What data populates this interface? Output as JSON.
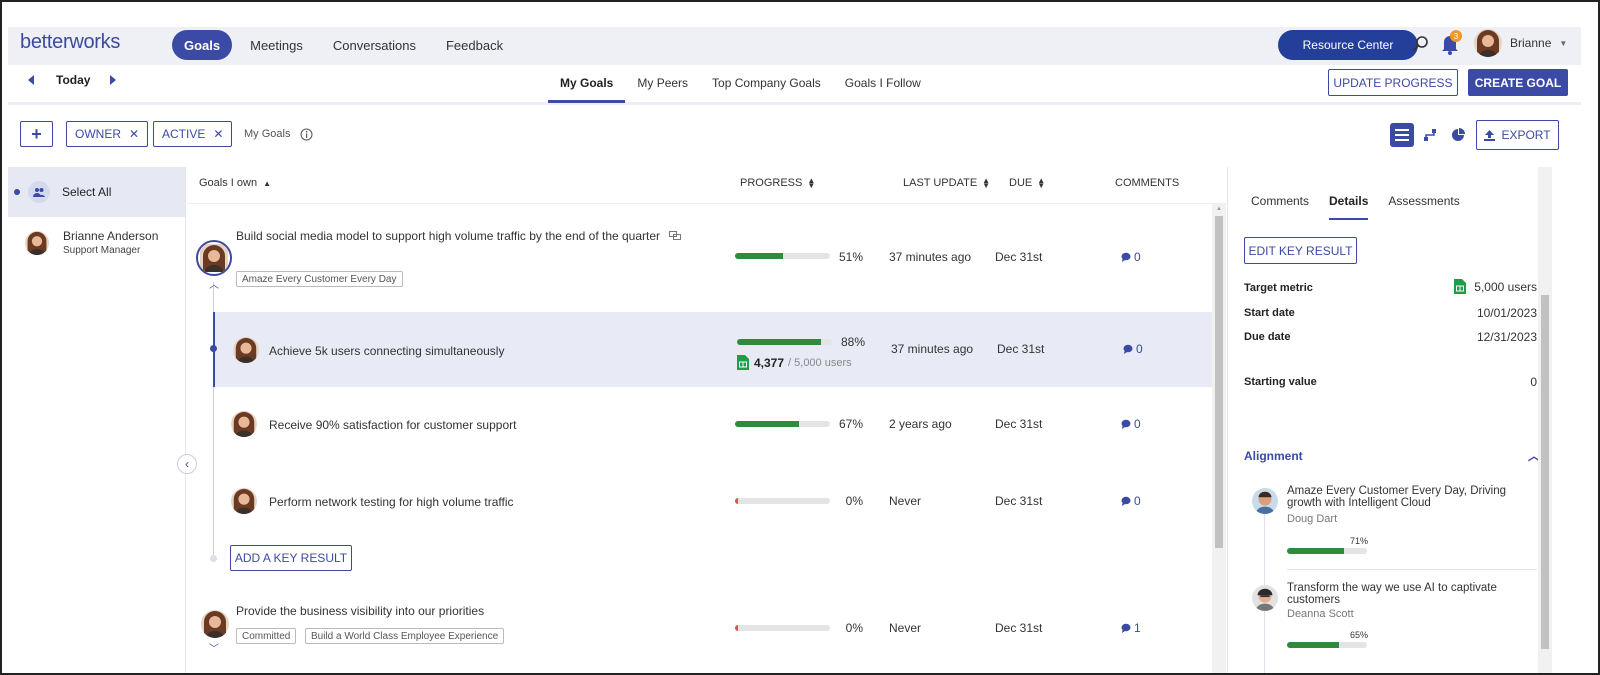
{
  "app": {
    "logo": "betterworks"
  },
  "nav": {
    "items": [
      {
        "label": "Goals",
        "active": true
      },
      {
        "label": "Meetings"
      },
      {
        "label": "Conversations"
      },
      {
        "label": "Feedback"
      }
    ],
    "resource_center": "Resource Center",
    "notification_count": "3",
    "user_name": "Brianne"
  },
  "subnav": {
    "date_label": "Today",
    "tabs": [
      {
        "label": "My Goals",
        "active": true
      },
      {
        "label": "My Peers"
      },
      {
        "label": "Top Company Goals"
      },
      {
        "label": "Goals I Follow"
      }
    ],
    "update_progress": "UPDATE PROGRESS",
    "create_goal": "CREATE GOAL"
  },
  "filters": {
    "add_label": "+",
    "chips": [
      {
        "label": "OWNER"
      },
      {
        "label": "ACTIVE"
      }
    ],
    "chip_close": "✕",
    "view_label": "My Goals",
    "export": "EXPORT"
  },
  "people": {
    "select_all": "Select All",
    "person": {
      "name": "Brianne Anderson",
      "role": "Support Manager"
    }
  },
  "table": {
    "headers": {
      "goals": "Goals I own",
      "progress": "PROGRESS",
      "last_update": "LAST UPDATE",
      "due": "DUE",
      "comments": "COMMENTS"
    },
    "goals": [
      {
        "title": "Build social media model to support high volume traffic by the end of the quarter",
        "tags": [
          "Amaze Every Customer Every Day"
        ],
        "progress": 51,
        "progress_label": "51%",
        "last_update": "37 minutes ago",
        "due": "Dec 31st",
        "comments": "0"
      },
      {
        "title": "Achieve 5k users connecting simultaneously",
        "progress": 88,
        "progress_label": "88%",
        "metric_current": "4,377",
        "metric_target": "/ 5,000 users",
        "last_update": "37 minutes ago",
        "due": "Dec 31st",
        "comments": "0"
      },
      {
        "title": "Receive 90% satisfaction for customer support",
        "progress": 67,
        "progress_label": "67%",
        "last_update": "2 years ago",
        "due": "Dec 31st",
        "comments": "0"
      },
      {
        "title": "Perform network testing for high volume traffic",
        "progress": 0,
        "progress_label": "0%",
        "last_update": "Never",
        "due": "Dec 31st",
        "comments": "0"
      },
      {
        "title": "Provide the business visibility into our priorities",
        "tags": [
          "Committed",
          "Build a World Class Employee Experience"
        ],
        "progress": 0,
        "progress_label": "0%",
        "last_update": "Never",
        "due": "Dec 31st",
        "comments": "1"
      }
    ],
    "add_key_result": "ADD A KEY RESULT"
  },
  "details": {
    "tabs": [
      {
        "label": "Comments"
      },
      {
        "label": "Details",
        "active": true
      },
      {
        "label": "Assessments"
      }
    ],
    "edit_key_result": "EDIT KEY RESULT",
    "target_metric_label": "Target metric",
    "target_metric_value": "5,000 users",
    "start_date_label": "Start date",
    "start_date_value": "10/01/2023",
    "due_date_label": "Due date",
    "due_date_value": "12/31/2023",
    "starting_value_label": "Starting value",
    "starting_value": "0",
    "alignment_label": "Alignment",
    "alignment": [
      {
        "title": "Amaze Every Customer Every Day, Driving growth with Intelligent Cloud",
        "owner": "Doug Dart",
        "progress": 71,
        "progress_label": "71%"
      },
      {
        "title": "Transform the way we use AI to captivate customers",
        "owner": "Deanna Scott",
        "progress": 65,
        "progress_label": "65%"
      }
    ]
  },
  "colors": {
    "brand": "#3b4aa5",
    "progress": "#2e8b3c",
    "resource": "#233f9a"
  }
}
